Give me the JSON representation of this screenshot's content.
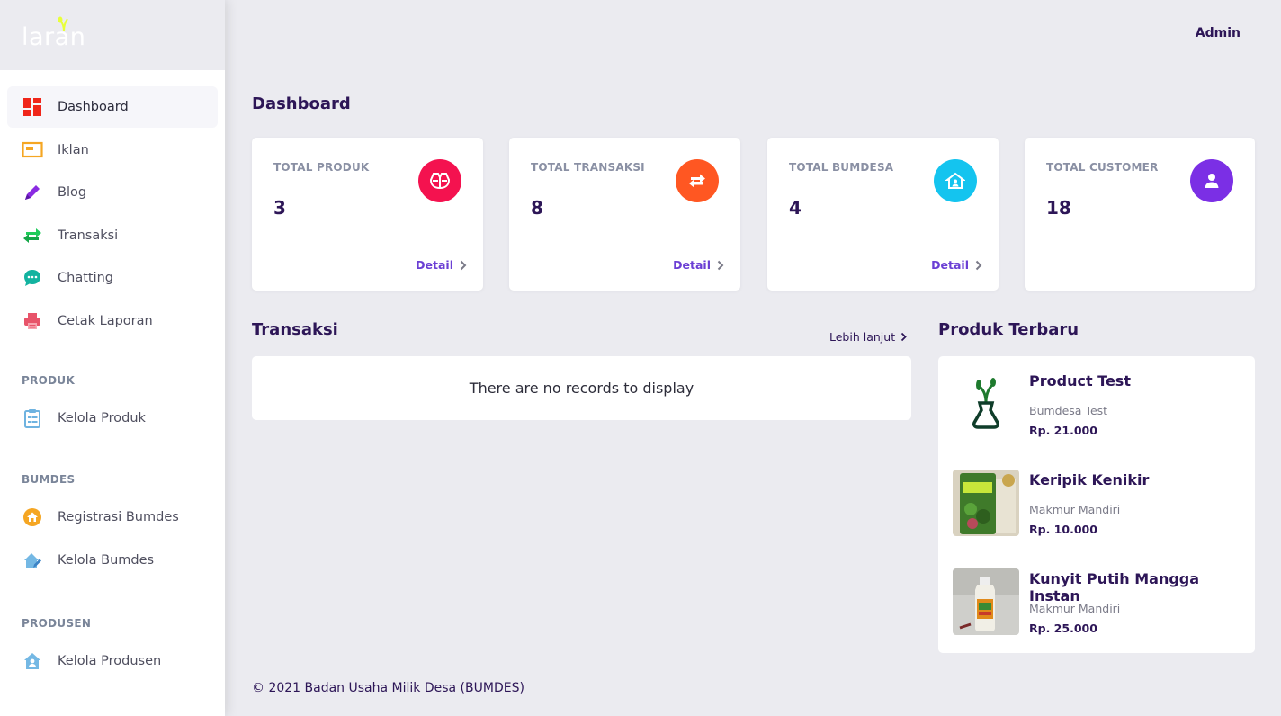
{
  "brand": {
    "logo_text": "laran"
  },
  "header": {
    "user": "Admin"
  },
  "sidebar": {
    "items": [
      {
        "label": "Dashboard"
      },
      {
        "label": "Iklan"
      },
      {
        "label": "Blog"
      },
      {
        "label": "Transaksi"
      },
      {
        "label": "Chatting"
      },
      {
        "label": "Cetak Laporan"
      }
    ],
    "produk_section": {
      "title": "PRODUK",
      "items": [
        {
          "label": "Kelola Produk"
        }
      ]
    },
    "bumdes_section": {
      "title": "BUMDES",
      "items": [
        {
          "label": "Registrasi Bumdes"
        },
        {
          "label": "Kelola Bumdes"
        }
      ]
    },
    "produsen_section": {
      "title": "PRODUSEN",
      "items": [
        {
          "label": "Kelola Produsen"
        }
      ]
    }
  },
  "main": {
    "title": "Dashboard",
    "stats": [
      {
        "title": "TOTAL PRODUK",
        "value": "3",
        "detail": "Detail",
        "icon": "box-icon",
        "color": "#f4124f"
      },
      {
        "title": "TOTAL TRANSAKSI",
        "value": "8",
        "detail": "Detail",
        "icon": "exchange-icon",
        "color": "#ff5722"
      },
      {
        "title": "TOTAL BUMDESA",
        "value": "4",
        "detail": "Detail",
        "icon": "house-icon",
        "color": "#14c4ef"
      },
      {
        "title": "TOTAL CUSTOMER",
        "value": "18",
        "icon": "user-icon",
        "color": "#7b2fe5"
      }
    ],
    "transaksi": {
      "title": "Transaksi",
      "more": "Lebih lanjut",
      "empty": "There are no records to display"
    },
    "produk_terbaru": {
      "title": "Produk Terbaru",
      "items": [
        {
          "name": "Product Test",
          "seller": "Bumdesa Test",
          "price": "Rp. 21.000",
          "image": "logo-bag-image"
        },
        {
          "name": "Keripik Kenikir",
          "seller": "Makmur Mandiri",
          "price": "Rp. 10.000",
          "image": "chips-package-image"
        },
        {
          "name": "Kunyit Putih Mangga Instan",
          "seller": "Makmur Mandiri",
          "price": "Rp. 25.000",
          "image": "bottle-image"
        }
      ]
    }
  },
  "footer": {
    "text": "© 2021 Badan Usaha Milik Desa (BUMDES)"
  }
}
